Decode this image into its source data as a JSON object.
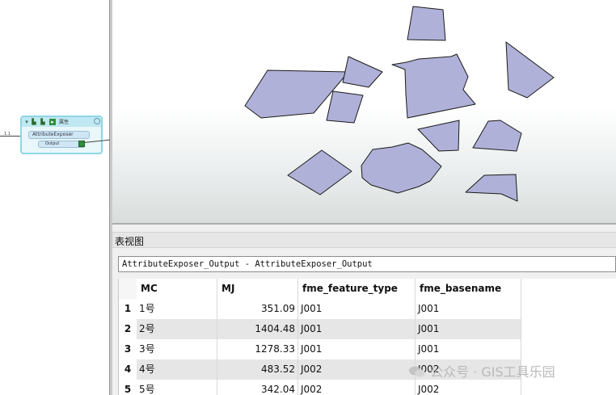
{
  "canvas": {
    "transformer": {
      "header_label": "属性",
      "input_port": "AttributeExposer",
      "output_port": "Output"
    },
    "link_label": "1 1"
  },
  "map_view": {
    "polygon_fill": "#b0b1d8",
    "polygon_stroke": "#1a1a1a"
  },
  "table_view": {
    "title": "表视图",
    "source": "AttributeExposer_Output - AttributeExposer_Output",
    "columns": [
      "MC",
      "MJ",
      "fme_feature_type",
      "fme_basename"
    ],
    "rows": [
      {
        "num": "1",
        "MC": "1号",
        "MJ": "351.09",
        "fme_feature_type": "J001",
        "fme_basename": "J001"
      },
      {
        "num": "2",
        "MC": "2号",
        "MJ": "1404.48",
        "fme_feature_type": "J001",
        "fme_basename": "J001"
      },
      {
        "num": "3",
        "MC": "3号",
        "MJ": "1278.33",
        "fme_feature_type": "J001",
        "fme_basename": "J001"
      },
      {
        "num": "4",
        "MC": "4号",
        "MJ": "483.52",
        "fme_feature_type": "J002",
        "fme_basename": "J002"
      },
      {
        "num": "5",
        "MC": "5号",
        "MJ": "342.04",
        "fme_feature_type": "J002",
        "fme_basename": "J002"
      }
    ]
  },
  "watermark": "公众号 · GIS工具乐园"
}
